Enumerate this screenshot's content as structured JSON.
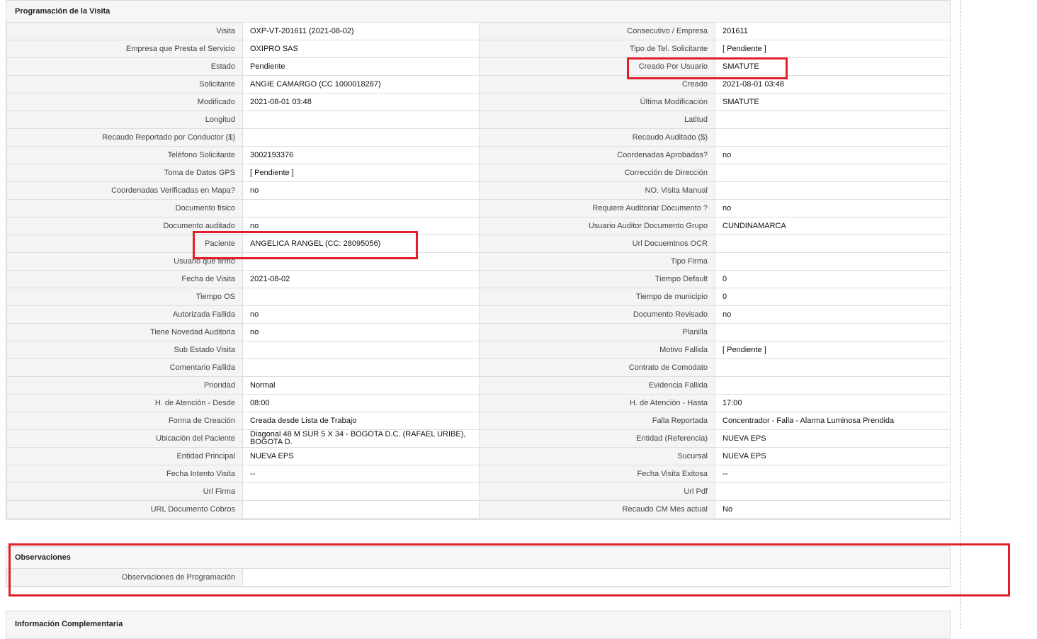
{
  "sections": {
    "programacion": {
      "title": "Programación de la Visita"
    },
    "observaciones": {
      "title": "Observaciones",
      "label": "Observaciones de Programación",
      "value": ""
    },
    "complementaria": {
      "title": "Información Complementaria"
    }
  },
  "rows": [
    [
      "Visita",
      "OXP-VT-201611 (2021-08-02)",
      "Consecutivo / Empresa",
      "201611"
    ],
    [
      "Empresa que Presta el Servicio",
      "OXIPRO SAS",
      "Tipo de Tel. Solicitante",
      "[ Pendiente ]"
    ],
    [
      "Estado",
      "Pendiente",
      "Creado Por Usuario",
      "SMATUTE"
    ],
    [
      "Solicitante",
      "ANGIE CAMARGO (CC 1000018287)",
      "Creado",
      "2021-08-01 03:48"
    ],
    [
      "Modificado",
      "2021-08-01 03:48",
      "Última Modificación",
      " SMATUTE"
    ],
    [
      "Longitud",
      "",
      "Latitud",
      ""
    ],
    [
      "Recaudo Reportado por Conductor ($)",
      "",
      "Recaudo Auditado ($)",
      ""
    ],
    [
      "Teléfono Solicitante",
      "3002193376",
      "Coordenadas Aprobadas?",
      " no"
    ],
    [
      "Toma de Datos GPS",
      "[ Pendiente ]",
      "Corrección de Dirección",
      ""
    ],
    [
      "Coordenadas Verificadas en Mapa?",
      " no",
      "NO. Visita Manual",
      ""
    ],
    [
      "Documento fisico",
      "",
      "Requiere Auditoriar Documento ?",
      " no"
    ],
    [
      "Documento auditado",
      " no",
      "Usuario Auditor Documento Grupo",
      "CUNDINAMARCA"
    ],
    [
      "Paciente",
      "ANGELICA RANGEL (CC: 28095056)",
      "Url Docuemtnos OCR",
      ""
    ],
    [
      "Usuario que firmo",
      "",
      "Tipo Firma",
      ""
    ],
    [
      "Fecha de Visita",
      " 2021-08-02",
      "Tiempo Default",
      " 0"
    ],
    [
      "Tiempo OS",
      "",
      "Tiempo de municipio",
      " 0"
    ],
    [
      "Autorizada Fallida",
      " no",
      "Documento Revisado",
      " no"
    ],
    [
      "Tiene Novedad Auditoria",
      " no",
      "Planilla",
      ""
    ],
    [
      "Sub Estado Visita",
      "",
      "Motivo Fallida",
      "[ Pendiente ]"
    ],
    [
      "Comentario Fallida",
      "",
      "Contrato de Comodato",
      ""
    ],
    [
      "Prioridad",
      "Normal",
      "Evidencia Fallida",
      ""
    ],
    [
      "H. de Atención - Desde",
      "08:00",
      "H. de Atención - Hasta",
      "17:00"
    ],
    [
      "Forma de Creación",
      "Creada desde Lista de Trabajo",
      "Falla Reportada",
      "Concentrador - Falla - Alarma Luminosa Prendida"
    ],
    [
      "Ubicación del Paciente",
      "Diagonal 48 M SUR 5 X 34 - BOGOTA D.C. (RAFAEL URIBE), BOGOTA D.",
      "Entidad (Referencia)",
      "NUEVA EPS"
    ],
    [
      "Entidad Principal",
      "NUEVA EPS",
      "Sucursal",
      "NUEVA EPS"
    ],
    [
      "Fecha Intento Visita",
      " --",
      "Fecha Visita Exitosa",
      " --"
    ],
    [
      "Url Firma",
      "",
      "Url Pdf",
      ""
    ],
    [
      "URL Documento Cobros",
      "",
      "Recaudo CM Mes actual",
      " No"
    ]
  ],
  "colors": {
    "highlight": "#e01f2a",
    "label_bg": "#f4f4f4",
    "border": "#dedede"
  }
}
